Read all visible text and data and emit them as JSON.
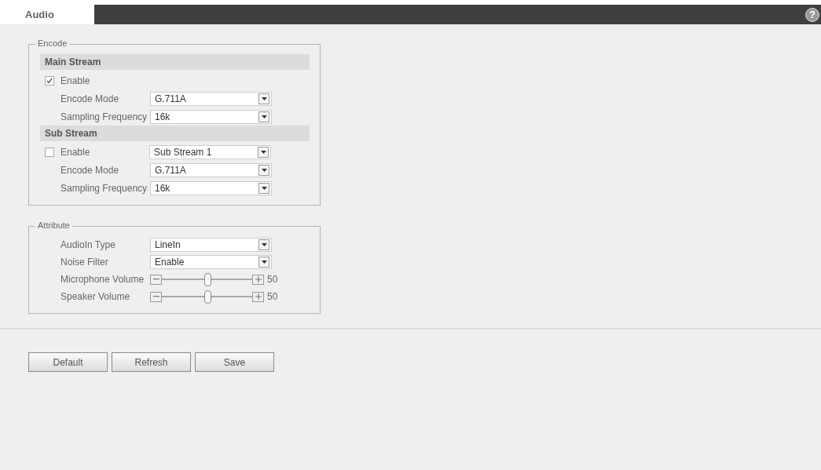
{
  "tab": {
    "label": "Audio",
    "selected": true
  },
  "help": "?",
  "encode": {
    "title": "Encode",
    "streams": [
      {
        "title": "Main Stream",
        "enable": {
          "label": "Enable",
          "checked": true
        },
        "fields": [
          {
            "label": "Encode Mode",
            "value": "G.711A"
          },
          {
            "label": "Sampling Frequency",
            "value": "16k"
          }
        ]
      },
      {
        "title": "Sub Stream",
        "enable": {
          "label": "Enable",
          "checked": false,
          "select": "Sub Stream 1"
        },
        "fields": [
          {
            "label": "Encode Mode",
            "value": "G.711A"
          },
          {
            "label": "Sampling Frequency",
            "value": "16k"
          }
        ]
      }
    ]
  },
  "attribute": {
    "title": "Attribute",
    "rows": [
      {
        "kind": "select",
        "label": "AudioIn Type",
        "value": "LineIn"
      },
      {
        "kind": "select",
        "label": "Noise Filter",
        "value": "Enable"
      },
      {
        "kind": "slider",
        "label": "Microphone Volume",
        "level": 0.5,
        "reading": "50"
      },
      {
        "kind": "slider",
        "label": "Speaker Volume",
        "level": 0.5,
        "reading": "50"
      }
    ]
  },
  "buttons": [
    "Default",
    "Refresh",
    "Save"
  ]
}
